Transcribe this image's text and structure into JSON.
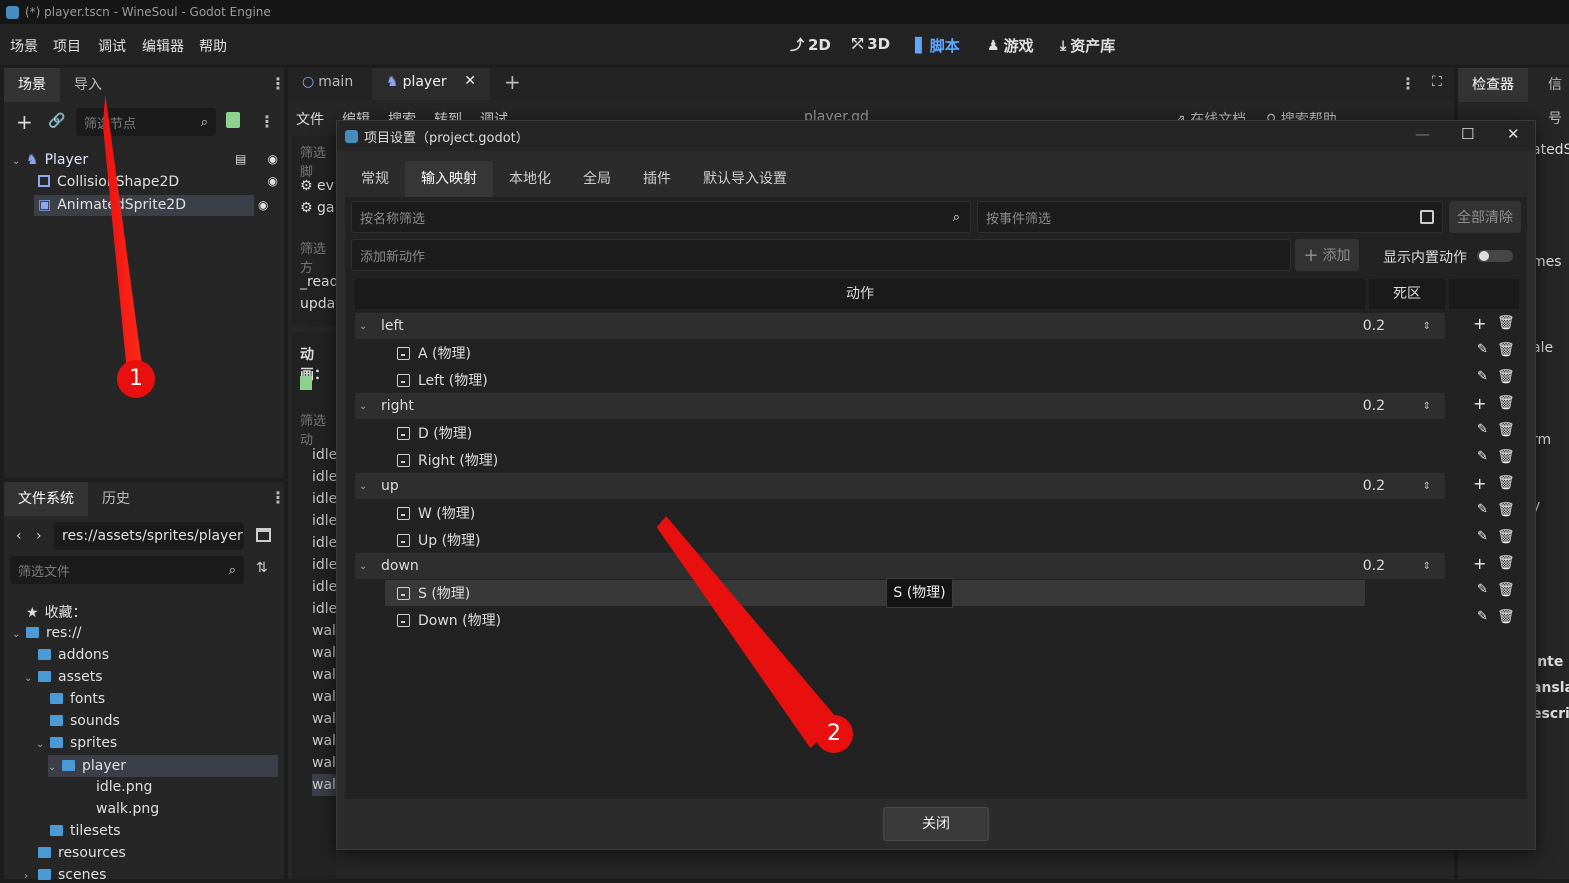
{
  "window_title": "(*) player.tscn - WineSoul - Godot Engine",
  "menu": [
    "场景",
    "项目",
    "调试",
    "编辑器",
    "帮助"
  ],
  "workspaces": [
    {
      "label": "2D",
      "icon": "2d-icon",
      "active": false
    },
    {
      "label": "3D",
      "icon": "3d-icon",
      "active": false
    },
    {
      "label": "脚本",
      "icon": "script-icon",
      "active": true
    },
    {
      "label": "游戏",
      "icon": "game-icon",
      "active": false
    },
    {
      "label": "资产库",
      "icon": "assetlib-icon",
      "active": false
    }
  ],
  "scene_dock": {
    "tabs": [
      "场景",
      "导入"
    ],
    "filter_placeholder": "筛选节点",
    "nodes": [
      "Player",
      "CollisionShape2D",
      "AnimatedSprite2D"
    ]
  },
  "fs_dock": {
    "tabs": [
      "文件系统",
      "历史"
    ],
    "path": "res://assets/sprites/player",
    "filter_placeholder": "筛选文件",
    "favorites": "收藏：",
    "items": [
      "res://",
      "addons",
      "assets",
      "fonts",
      "sounds",
      "sprites",
      "player",
      "idle.png",
      "walk.png",
      "tilesets",
      "resources",
      "scenes"
    ]
  },
  "editor_tabs": [
    "main",
    "player"
  ],
  "script_menu": [
    "文件",
    "编辑",
    "搜索",
    "转到",
    "调试"
  ],
  "script_file": "player.gd",
  "script_links": [
    "在线文档",
    "搜索帮助"
  ],
  "inspector_tabs": [
    "检查器",
    "信号"
  ],
  "behind_fragments": {
    "filter1": "筛选脚",
    "ev": "ev",
    "ga": "ga",
    "filter2": "筛选方",
    "ready": "_read",
    "upda": "updat",
    "anim": "动画：",
    "filter3": "筛选动",
    "anims": [
      "idle",
      "idle",
      "idle",
      "idle",
      "idle",
      "idle",
      "idle",
      "idle",
      "wal",
      "wal",
      "wal",
      "wal",
      "wal",
      "wal",
      "wal",
      "wal"
    ],
    "right": [
      "atedS",
      "mes",
      "ale",
      "rm",
      "y",
      "Inte",
      "ansla",
      "escri"
    ]
  },
  "dialog": {
    "title": "项目设置（project.godot）",
    "tabs": [
      "常规",
      "输入映射",
      "本地化",
      "全局",
      "插件",
      "默认导入设置"
    ],
    "active_tab": "输入映射",
    "filter_name_placeholder": "按名称筛选",
    "filter_event_placeholder": "按事件筛选",
    "clear_all": "全部清除",
    "add_action_placeholder": "添加新动作",
    "add_button": "添加",
    "show_builtin": "显示内置动作",
    "col_action": "动作",
    "col_deadzone": "死区",
    "actions": [
      {
        "name": "left",
        "deadzone": "0.2",
        "events": [
          "A (物理)",
          "Left (物理)"
        ]
      },
      {
        "name": "right",
        "deadzone": "0.2",
        "events": [
          "D (物理)",
          "Right (物理)"
        ]
      },
      {
        "name": "up",
        "deadzone": "0.2",
        "events": [
          "W (物理)",
          "Up (物理)"
        ]
      },
      {
        "name": "down",
        "deadzone": "0.2",
        "events": [
          "S (物理)",
          "Down (物理)"
        ]
      }
    ],
    "tooltip": "S (物理)",
    "close_button": "关闭"
  },
  "annotations": [
    "1",
    "2"
  ],
  "colors": {
    "accent": "#478cbf",
    "active_workspace": "#5ea7ff",
    "annotation_red": "#e8100f"
  }
}
